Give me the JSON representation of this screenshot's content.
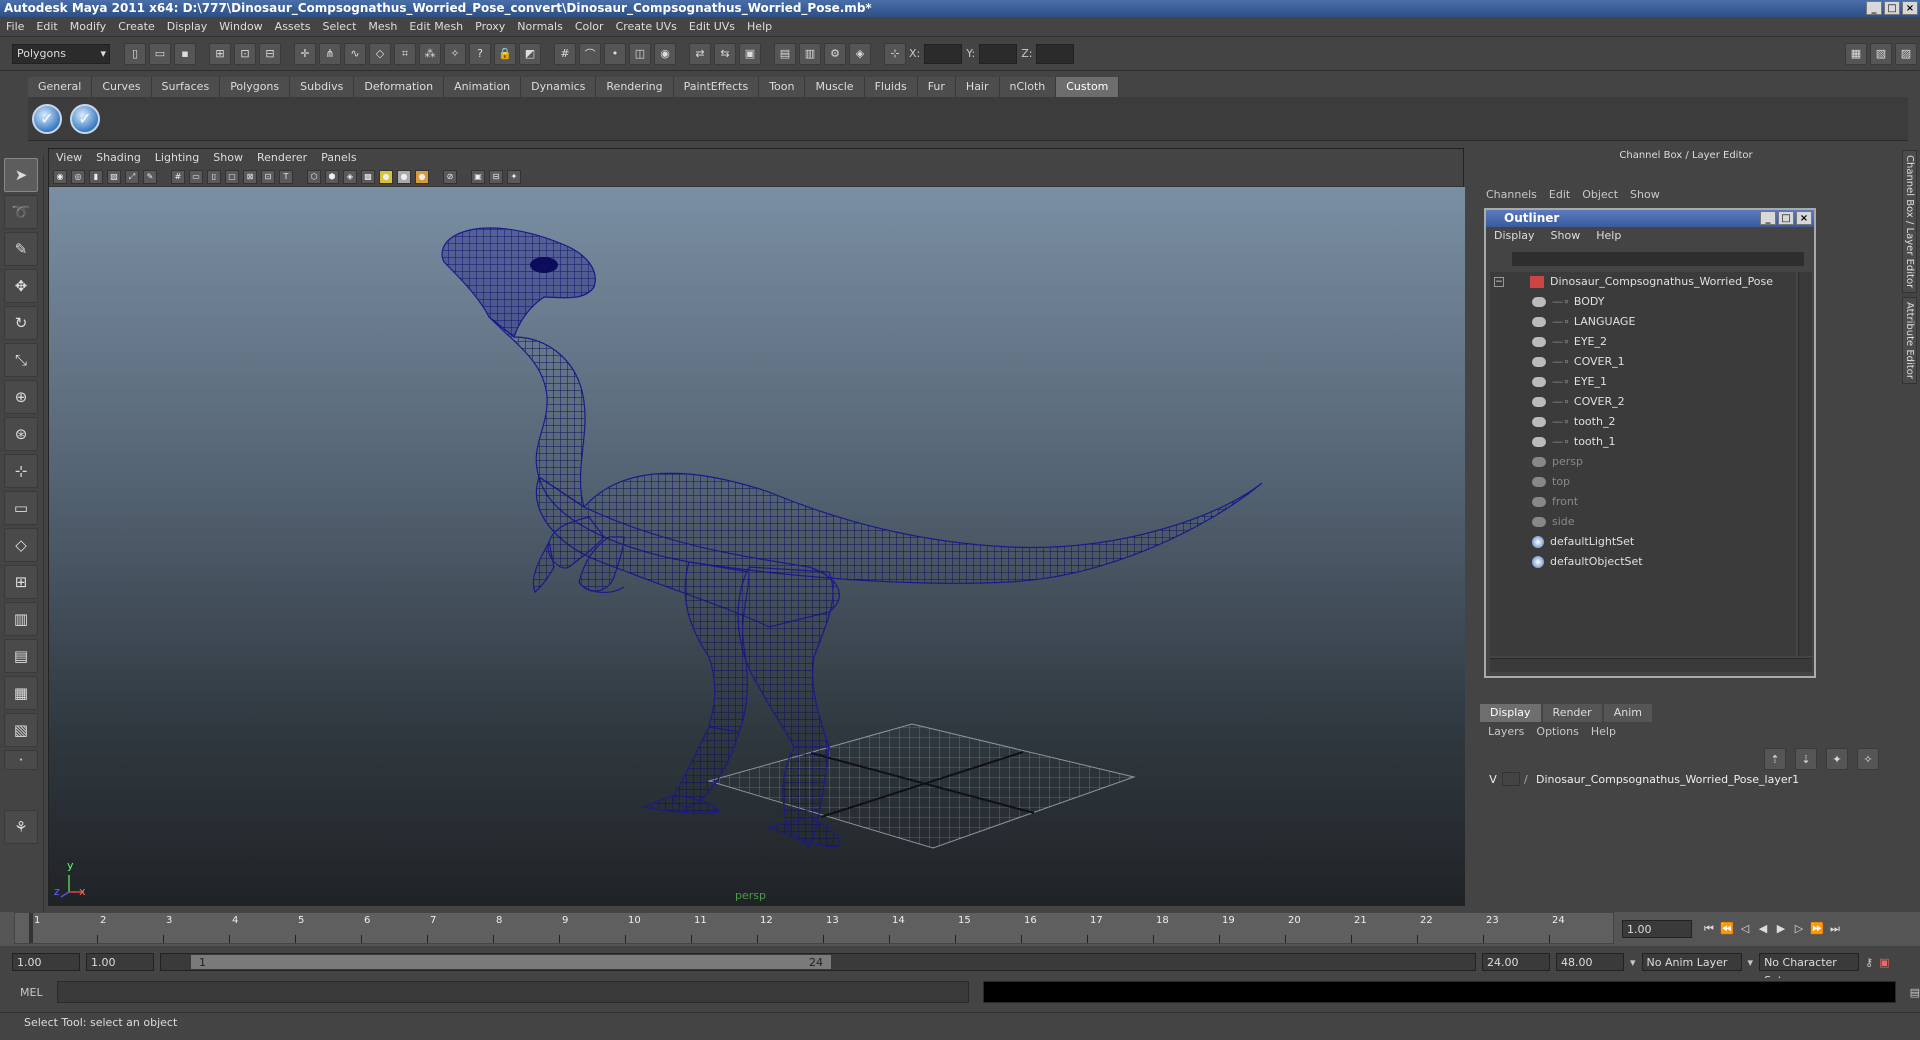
{
  "window": {
    "title": "Autodesk Maya 2011 x64: D:\\777\\Dinosaur_Compsognathus_Worried_Pose_convert\\Dinosaur_Compsognathus_Worried_Pose.mb*"
  },
  "menubar": [
    "File",
    "Edit",
    "Modify",
    "Create",
    "Display",
    "Window",
    "Assets",
    "Select",
    "Mesh",
    "Edit Mesh",
    "Proxy",
    "Normals",
    "Color",
    "Create UVs",
    "Edit UVs",
    "Help"
  ],
  "statusline": {
    "mode": "Polygons",
    "x_label": "X:",
    "y_label": "Y:",
    "z_label": "Z:"
  },
  "shelf": {
    "tabs": [
      "General",
      "Curves",
      "Surfaces",
      "Polygons",
      "Subdivs",
      "Deformation",
      "Animation",
      "Dynamics",
      "Rendering",
      "PaintEffects",
      "Toon",
      "Muscle",
      "Fluids",
      "Fur",
      "Hair",
      "nCloth",
      "Custom"
    ],
    "active": "Custom"
  },
  "viewport": {
    "menu": [
      "View",
      "Shading",
      "Lighting",
      "Show",
      "Renderer",
      "Panels"
    ],
    "camera_label": "persp",
    "axis_y": "y",
    "axis_x": "x",
    "axis_z": "z"
  },
  "channelbox": {
    "title": "Channel Box / Layer Editor",
    "menu": [
      "Channels",
      "Edit",
      "Object",
      "Show"
    ]
  },
  "sidetabs": [
    "Channel Box / Layer Editor",
    "Attribute Editor"
  ],
  "outliner": {
    "title": "Outliner",
    "menu": [
      "Display",
      "Show",
      "Help"
    ],
    "items": [
      {
        "label": "Dinosaur_Compsognathus_Worried_Pose",
        "level": 0,
        "dim": false
      },
      {
        "label": "BODY",
        "level": 1,
        "dim": false
      },
      {
        "label": "LANGUAGE",
        "level": 1,
        "dim": false
      },
      {
        "label": "EYE_2",
        "level": 1,
        "dim": false
      },
      {
        "label": "COVER_1",
        "level": 1,
        "dim": false
      },
      {
        "label": "EYE_1",
        "level": 1,
        "dim": false
      },
      {
        "label": "COVER_2",
        "level": 1,
        "dim": false
      },
      {
        "label": "tooth_2",
        "level": 1,
        "dim": false
      },
      {
        "label": "tooth_1",
        "level": 1,
        "dim": false
      },
      {
        "label": "persp",
        "level": 0,
        "dim": true
      },
      {
        "label": "top",
        "level": 0,
        "dim": true
      },
      {
        "label": "front",
        "level": 0,
        "dim": true
      },
      {
        "label": "side",
        "level": 0,
        "dim": true
      },
      {
        "label": "defaultLightSet",
        "level": 0,
        "dim": false
      },
      {
        "label": "defaultObjectSet",
        "level": 0,
        "dim": false
      }
    ]
  },
  "layereditor": {
    "tabs": [
      "Display",
      "Render",
      "Anim"
    ],
    "menu": [
      "Layers",
      "Options",
      "Help"
    ],
    "layer_visible": "V",
    "layer_name": "Dinosaur_Compsognathus_Worried_Pose_layer1"
  },
  "timeline": {
    "ticks": [
      "1",
      "2",
      "3",
      "4",
      "5",
      "6",
      "7",
      "8",
      "9",
      "10",
      "11",
      "12",
      "13",
      "14",
      "15",
      "16",
      "17",
      "18",
      "19",
      "20",
      "21",
      "22",
      "23",
      "24"
    ],
    "current_frame": "1.00"
  },
  "range": {
    "start": "1.00",
    "start2": "1.00",
    "slider_start": "1",
    "slider_end": "24",
    "end": "24.00",
    "end2": "48.00",
    "anim_layer": "No Anim Layer",
    "char_set": "No Character Set"
  },
  "mel": {
    "label": "MEL"
  },
  "helpline": {
    "text": "Select Tool: select an object"
  },
  "colors": {
    "wire": "#1a1a8c",
    "accent": "#3a5a9b"
  }
}
